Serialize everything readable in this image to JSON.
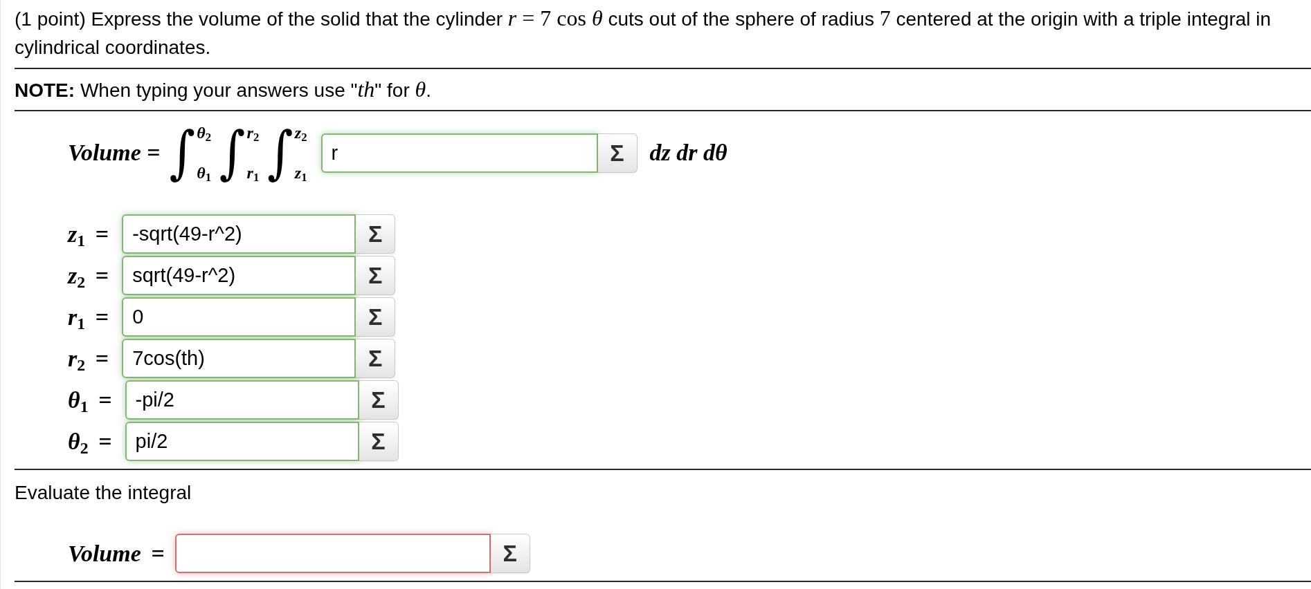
{
  "question": [
    {
      "kind": "text",
      "text": "(1 point) Express the volume of the solid that the cylinder "
    },
    {
      "kind": "math",
      "text": "*r* = 7 cos *θ*"
    },
    {
      "kind": "text",
      "text": " cuts out of the sphere of radius "
    },
    {
      "kind": "math",
      "text": "7"
    },
    {
      "kind": "text",
      "text": " centered at the origin with a triple integral in cylindrical coordinates."
    }
  ],
  "note": [
    {
      "kind": "text",
      "text": "**NOTE:** When typing your answers use \""
    },
    {
      "kind": "math",
      "text": "*th*"
    },
    {
      "kind": "text",
      "text": "\" for "
    },
    {
      "kind": "math",
      "text": "*θ*"
    },
    {
      "kind": "text",
      "text": "."
    }
  ],
  "integral": {
    "label": "*Volume* =",
    "integrals": [
      {
        "symbol": "∫",
        "upper": "*θ*$_{2}$",
        "lower": "*θ*$_{1}$"
      },
      {
        "symbol": "∫",
        "upper": "*r*$_{2}$",
        "lower": "*r*$_{1}$"
      },
      {
        "symbol": "∫",
        "upper": "*z*$_{2}$",
        "lower": "*z*$_{1}$"
      }
    ],
    "integrand": {
      "value": "r",
      "correct": true,
      "button": "Σ"
    },
    "differentials": "dz dr dθ"
  },
  "limits": [
    {
      "label": "*z*$_{1}$ =",
      "value": "-sqrt(49-r^2)",
      "correct": true,
      "button": "Σ"
    },
    {
      "label": "*z*$_{2}$ =",
      "value": "sqrt(49-r^2)",
      "correct": true,
      "button": "Σ"
    },
    {
      "label": "*r*$_{1}$ =",
      "value": "0",
      "correct": true,
      "button": "Σ"
    },
    {
      "label": "*r*$_{2}$ =",
      "value": "7cos(th)",
      "correct": true,
      "button": "Σ"
    },
    {
      "label": "*θ*$_{1}$ =",
      "value": "-pi/2",
      "correct": true,
      "button": "Σ"
    },
    {
      "label": "*θ*$_{2}$ =",
      "value": "pi/2",
      "correct": true,
      "button": "Σ"
    }
  ],
  "evaluate": {
    "prompt": "Evaluate the integral",
    "label": "*Volume* =",
    "answer": {
      "correct": false,
      "button": "Σ"
    }
  }
}
